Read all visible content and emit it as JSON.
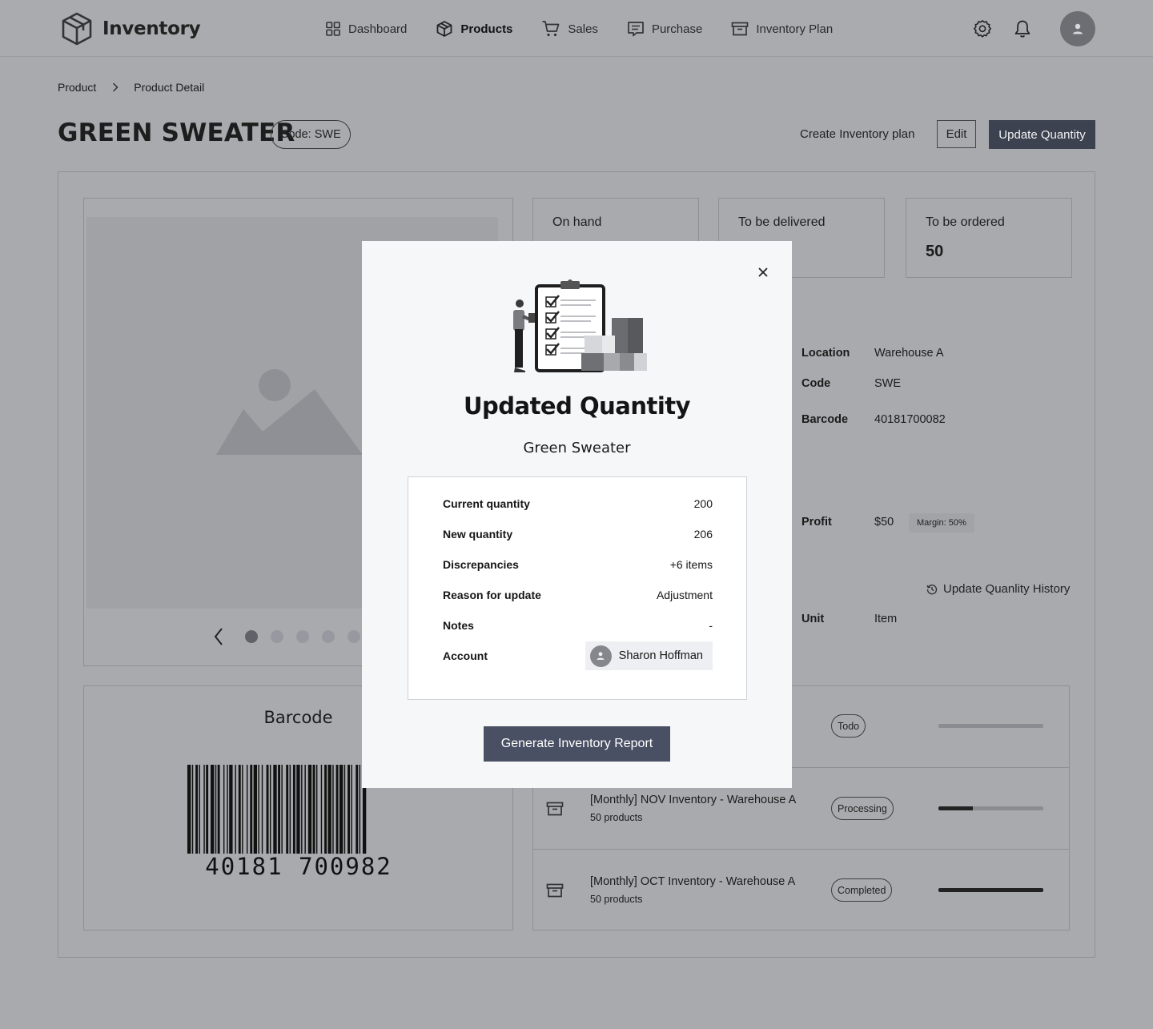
{
  "app": {
    "name": "Inventory"
  },
  "nav": {
    "items": [
      {
        "label": "Dashboard",
        "icon": "dashboard-grid-icon",
        "active": false
      },
      {
        "label": "Products",
        "icon": "box-icon",
        "active": true
      },
      {
        "label": "Sales",
        "icon": "cart-icon",
        "active": false
      },
      {
        "label": "Purchase",
        "icon": "receipt-icon",
        "active": false
      },
      {
        "label": "Inventory Plan",
        "icon": "archive-icon",
        "active": false
      }
    ],
    "utility_icons": [
      "gear-icon",
      "bell-icon",
      "user-avatar-icon"
    ]
  },
  "breadcrumb": {
    "root": "Product",
    "current": "Product Detail"
  },
  "product": {
    "title": "GREEN SWEATER",
    "code_chip": "Code: SWE"
  },
  "actions": {
    "create_plan": "Create Inventory plan",
    "edit": "Edit",
    "update_quantity": "Update Quantity"
  },
  "stats": {
    "on_hand_label": "On hand",
    "to_be_delivered_label": "To be delivered",
    "to_be_ordered_label": "To be ordered",
    "to_be_ordered_value": "50"
  },
  "details": {
    "location_label": "Location",
    "location_value": "Warehouse A",
    "code_label": "Code",
    "code_value": "SWE",
    "barcode_label": "Barcode",
    "barcode_value": "40181700082",
    "profit_label": "Profit",
    "profit_value": "$50",
    "margin": "Margin: 50%",
    "history_link": "Update Quanlity History",
    "unit_label": "Unit",
    "unit_value": "Item"
  },
  "barcode_card": {
    "title": "Barcode",
    "number": "40181 700982"
  },
  "plans": [
    {
      "title": "",
      "subtitle": "",
      "status": "Todo",
      "progress": 0
    },
    {
      "title": "[Monthly] NOV Inventory - Warehouse A",
      "subtitle": "50 products",
      "status": "Processing",
      "progress": 0.33
    },
    {
      "title": "[Monthly] OCT Inventory - Warehouse A",
      "subtitle": "50 products",
      "status": "Completed",
      "progress": 1.0
    }
  ],
  "modal": {
    "title": "Updated Quantity",
    "subtitle": "Green Sweater",
    "rows": {
      "current_quantity_label": "Current quantity",
      "current_quantity_value": "200",
      "new_quantity_label": "New quantity",
      "new_quantity_value": "206",
      "discrepancies_label": "Discrepancies",
      "discrepancies_value": "+6 items",
      "reason_label": "Reason for update",
      "reason_value": "Adjustment",
      "notes_label": "Notes",
      "notes_value": "-",
      "account_label": "Account",
      "account_value": "Sharon Hoffman"
    },
    "button": "Generate Inventory Report"
  },
  "colors": {
    "overlay_background": "#a9aaae",
    "primary_button": "#3d4250",
    "modal_button": "#4a5063",
    "modal_background": "#f6f7f9"
  }
}
